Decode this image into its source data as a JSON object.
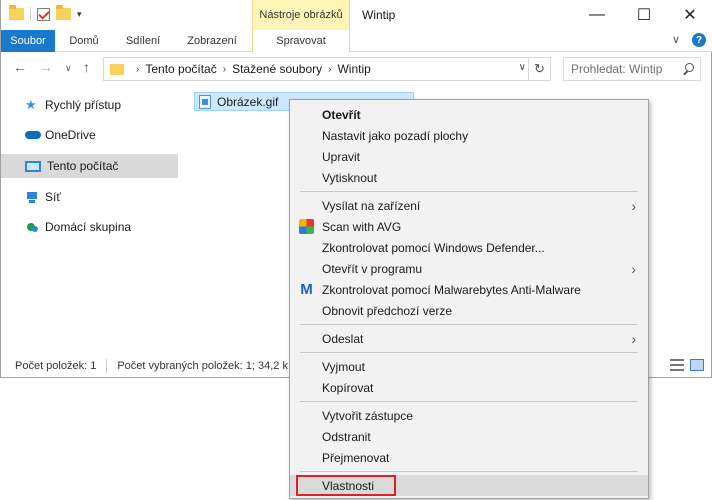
{
  "titlebar": {
    "context_tab_header": "Nástroje obrázků",
    "title": "Wintip",
    "minimize": "—",
    "maximize": "☐",
    "close": "✕"
  },
  "ribbon": {
    "tabs": [
      "Soubor",
      "Domů",
      "Sdílení",
      "Zobrazení",
      "Spravovat"
    ],
    "expand": "∨",
    "help": "?"
  },
  "address": {
    "breadcrumbs": [
      "Tento počítač",
      "Stažené soubory",
      "Wintip"
    ],
    "search_placeholder": "Prohledat: Wintip"
  },
  "navpane": {
    "items": [
      {
        "label": "Rychlý přístup",
        "icon": "star-icon"
      },
      {
        "label": "OneDrive",
        "icon": "cloud-icon"
      },
      {
        "label": "Tento počítač",
        "icon": "computer-icon",
        "selected": true
      },
      {
        "label": "Síť",
        "icon": "network-icon"
      },
      {
        "label": "Domácí skupina",
        "icon": "homegroup-icon"
      }
    ]
  },
  "files": [
    {
      "name": "Obrázek.gif",
      "selected": true
    }
  ],
  "status": {
    "count": "Počet položek: 1",
    "selected": "Počet vybraných položek: 1; 34,2 k"
  },
  "context_menu": {
    "groups": [
      [
        {
          "label": "Otevřít",
          "bold": true
        },
        {
          "label": "Nastavit jako pozadí plochy"
        },
        {
          "label": "Upravit"
        },
        {
          "label": "Vytisknout"
        }
      ],
      [
        {
          "label": "Vysílat na zařízení",
          "submenu": true
        },
        {
          "label": "Scan with AVG",
          "icon": "avg-icon"
        },
        {
          "label": "Zkontrolovat pomocí Windows Defender..."
        },
        {
          "label": "Otevřít v programu",
          "submenu": true
        },
        {
          "label": "Zkontrolovat pomocí Malwarebytes Anti-Malware",
          "icon": "malwarebytes-icon"
        },
        {
          "label": "Obnovit předchozí verze"
        }
      ],
      [
        {
          "label": "Odeslat",
          "submenu": true
        }
      ],
      [
        {
          "label": "Vyjmout"
        },
        {
          "label": "Kopírovat"
        }
      ],
      [
        {
          "label": "Vytvořit zástupce"
        },
        {
          "label": "Odstranit"
        },
        {
          "label": "Přejmenovat"
        }
      ],
      [
        {
          "label": "Vlastnosti",
          "highlighted": true
        }
      ]
    ]
  },
  "colors": {
    "file_tab": "#1979ca",
    "context_tab": "#fdf5b8",
    "selection": "#cce8ff",
    "highlight_box": "#dd2222"
  }
}
